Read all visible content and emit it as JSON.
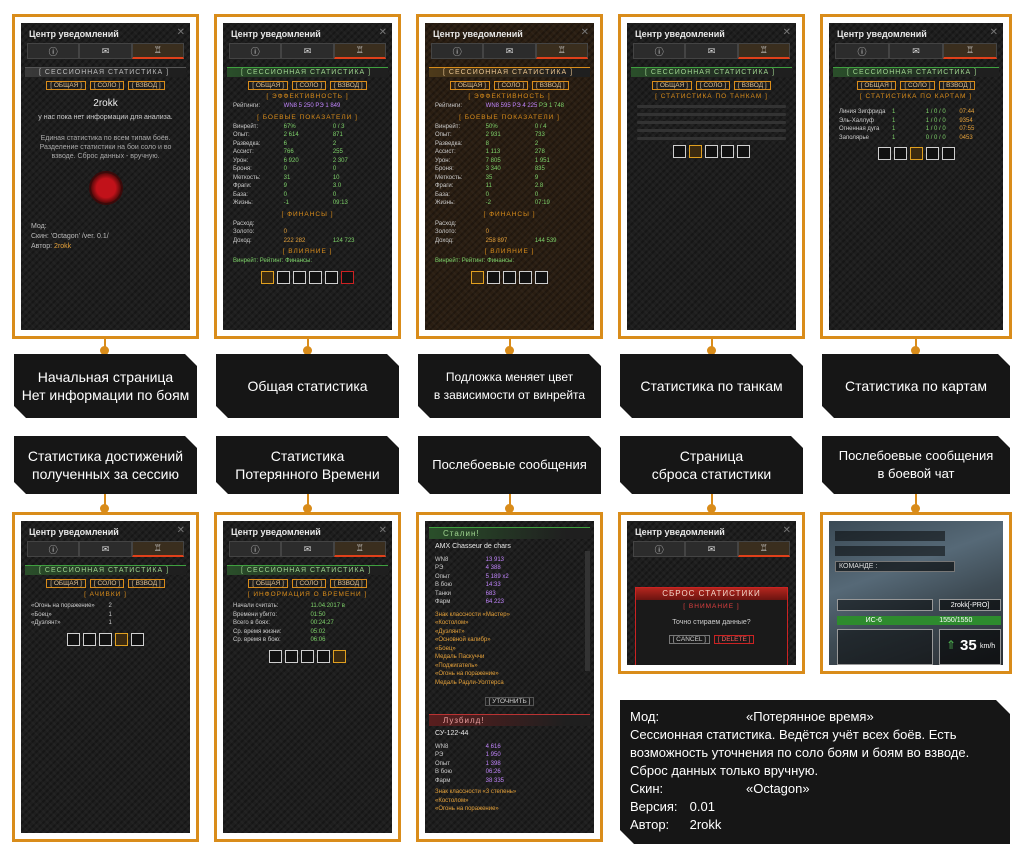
{
  "panels": {
    "title": "Центр уведомлений",
    "session_header": "[ СЕССИОННАЯ СТАТИСТИКА ]",
    "modes": [
      "[ ОБЩАЯ ]",
      "[ СОЛО ]",
      "[ ВЗВОД ]"
    ],
    "start_page": {
      "player": "2rokk",
      "no_info": "у нас пока нет информации для анализа.",
      "desc": "Единая статистика по всем типам боёв. Разделение статистики на бои соло и во взводе. Сброс данных - вручную.",
      "mod_label": "Мод:",
      "skin_label": "Скин: 'Octagon' /ver. 0.1/",
      "author_label": "Автор:",
      "author": "2rokk"
    },
    "general": {
      "efficiency": "[ ЭФФЕКТИВНОСТЬ ]",
      "rating_label": "Рейтинги:",
      "rating_values": [
        "WN8 5 250",
        "РЭ 1 849"
      ],
      "combat": "[ БОЕВЫЕ ПОКАЗАТЕЛИ ]",
      "rows": [
        {
          "k": "Винрейт:",
          "a": "67%",
          "b": "0 / 3"
        },
        {
          "k": "Опыт:",
          "a": "2 614",
          "b": "871"
        },
        {
          "k": "Разведка:",
          "a": "6",
          "b": "2"
        },
        {
          "k": "Ассист:",
          "a": "766",
          "b": "255"
        },
        {
          "k": "Урон:",
          "a": "6 920",
          "b": "2 307"
        },
        {
          "k": "Броня:",
          "a": "0",
          "b": "0"
        },
        {
          "k": "Меткость:",
          "a": "31",
          "b": "10"
        },
        {
          "k": "Фраги:",
          "a": "9",
          "b": "3.0"
        },
        {
          "k": "База:",
          "a": "0",
          "b": "0"
        },
        {
          "k": "Жизнь:",
          "a": "-1",
          "b": "09:13"
        }
      ],
      "finance": "[ ФИНАНСЫ ]",
      "fin_rows": [
        {
          "k": "Расход:",
          "a": "",
          "b": ""
        },
        {
          "k": "Золото:",
          "a": "0",
          "b": ""
        },
        {
          "k": "Доход:",
          "a": "222 282",
          "b": "124 723"
        }
      ],
      "influence": "[ ВЛИЯНИЕ ]",
      "influence_row": "Винрейт:  Рейтинг:  Финансы:"
    },
    "winrate_bg": {
      "rating_values": [
        "WN8 595",
        "РЭ 4 225",
        "РЭ 1 748"
      ],
      "rows": [
        {
          "k": "Винрейт:",
          "a": "50%",
          "b": "0 / 4"
        },
        {
          "k": "Опыт:",
          "a": "2 931",
          "b": "733"
        },
        {
          "k": "Разведка:",
          "a": "8",
          "b": "2"
        },
        {
          "k": "Ассист:",
          "a": "1 113",
          "b": "278"
        },
        {
          "k": "Урон:",
          "a": "7 805",
          "b": "1 951"
        },
        {
          "k": "Броня:",
          "a": "3 340",
          "b": "835"
        },
        {
          "k": "Меткость:",
          "a": "35",
          "b": "9"
        },
        {
          "k": "Фраги:",
          "a": "11",
          "b": "2.8"
        },
        {
          "k": "База:",
          "a": "0",
          "b": "0"
        },
        {
          "k": "Жизнь:",
          "a": "-2",
          "b": "07:19"
        }
      ],
      "fin_rows": [
        {
          "k": "Расход:",
          "a": "",
          "b": ""
        },
        {
          "k": "Золото:",
          "a": "0",
          "b": ""
        },
        {
          "k": "Доход:",
          "a": "258 897",
          "b": "144 539"
        }
      ]
    },
    "tanks": {
      "header": "[ СТАТИСТИКА ПО ТАНКАМ ]"
    },
    "maps": {
      "header": "[ СТАТИСТИКА ПО КАРТАМ ]",
      "rows": [
        {
          "k": "Линия Зигфрида",
          "a": "1",
          "b": "1 / 0 / 0",
          "c": "07:44"
        },
        {
          "k": "Эль-Халлуф",
          "a": "1",
          "b": "1 / 0 / 0",
          "c": "9354"
        },
        {
          "k": "Огненная дуга",
          "a": "1",
          "b": "1 / 0 / 0",
          "c": "07:55"
        },
        {
          "k": "Заполярье",
          "a": "1",
          "b": "0 / 0 / 0",
          "c": "0453"
        }
      ]
    },
    "achievements": {
      "header": "[ АЧИВКИ ]",
      "rows": [
        {
          "k": "«Огонь на поражение»",
          "a": "2"
        },
        {
          "k": "«Боец»",
          "a": "1"
        },
        {
          "k": "«Дуэлянт»",
          "a": "1"
        }
      ]
    },
    "lost_time": {
      "header": "[ ИНФОРМАЦИЯ О ВРЕМЕНИ ]",
      "rows": [
        {
          "k": "Начали считать:",
          "a": "11.04.2017 в 01:50"
        },
        {
          "k": "Времени убито:",
          "a": ""
        },
        {
          "k": "Всего в боях:",
          "a": "00:24:27"
        },
        {
          "k": "Ср. время жизни:",
          "a": "05:02"
        },
        {
          "k": "Ср. время в бою:",
          "a": "06:06"
        }
      ]
    },
    "postbattle": {
      "win_header": "Сталин!",
      "tank1": "AMX Chasseur de chars",
      "stats1": [
        {
          "k": "WN8",
          "a": "13 913"
        },
        {
          "k": "РЭ",
          "a": "4 388"
        },
        {
          "k": "Опыт",
          "a": "5 189 x2"
        },
        {
          "k": "В бою",
          "a": "14:33"
        },
        {
          "k": "Танки",
          "a": "683"
        },
        {
          "k": "Фарм",
          "a": "64 223"
        }
      ],
      "awards": [
        "Знак классности «Мастер»",
        "«Костолом»",
        "«Дуэлянт»",
        "«Основной калибр»",
        "«Боец»",
        "Медаль Паскуччи",
        "«Поджигатель»",
        "«Огонь на поражение»",
        "Медаль Радли-Уолтерса"
      ],
      "details_btn": "[ УТОЧНИТЬ ]",
      "loss_header": "Лузбилд!",
      "tank2": "СУ-122-44",
      "stats2": [
        {
          "k": "WN8",
          "a": "4 616"
        },
        {
          "k": "РЭ",
          "a": "1 950"
        },
        {
          "k": "Опыт",
          "a": "1 398"
        },
        {
          "k": "В бою",
          "a": "06:26"
        },
        {
          "k": "Фарм",
          "a": "38 335"
        }
      ],
      "awards2": [
        "Знак классности «3 степень»",
        "«Костолом»",
        "«Огонь на поражение»"
      ]
    },
    "reset": {
      "header": "СБРОС СТАТИСТИКИ",
      "attention": "[ ВНИМАНИЕ ]",
      "question": "Точно стираем данные?",
      "cancel": "[ CANCEL ]",
      "delete": "[ DELETE ]"
    },
    "battle_chat": {
      "team_label": "КОМАНДЕ :",
      "player_tag": "2rokk[-PRO]",
      "tank": "ИС-6",
      "hp": "1550/1550",
      "speed": "35",
      "speed_unit": "km/h"
    }
  },
  "captions": [
    "Начальная страница\nНет информации по боям",
    "Общая статистика",
    "Подложка меняет цвет\nв зависимости от винрейта",
    "Статистика по танкам",
    "Статистика по картам",
    "Статистика достижений\nполученных за сессию",
    "Статистика\nПотерянного Времени",
    "Послебоевые сообщения",
    "Страница\nсброса статистики",
    "Послебоевые сообщения\nв боевой чат"
  ],
  "info": {
    "mod_label": "Мод:",
    "mod_name": "«Потерянное время»",
    "description": "Сессионная статистика. Ведётся учёт всех боёв. Есть возможность уточнения по соло боям и боям во взводе. Сброс данных только вручную.",
    "skin_label": "Скин:",
    "skin": "«Octagon»",
    "version_label": "Версия:",
    "version": "0.01",
    "author_label": "Автор:",
    "author": "2rokk"
  }
}
